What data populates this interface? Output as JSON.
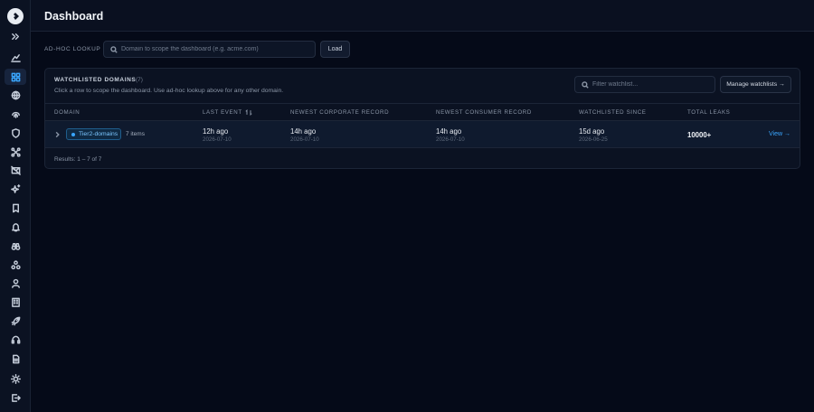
{
  "header": {
    "title": "Dashboard"
  },
  "lookup": {
    "label": "AD-HOC LOOKUP",
    "placeholder": "Domain to scope the dashboard (e.g. acme.com)",
    "value": "",
    "load_label": "Load"
  },
  "panel": {
    "title": "WATCHLISTED DOMAINS",
    "count": "(7)",
    "subtitle": "Click a row to scope the dashboard. Use ad-hoc lookup above for any other domain.",
    "filter_placeholder": "Filter watchlist...",
    "manage_label": "Manage watchlists →",
    "columns": [
      "DOMAIN",
      "LAST EVENT",
      "NEWEST CORPORATE RECORD",
      "NEWEST CONSUMER RECORD",
      "WATCHLISTED SINCE",
      "TOTAL LEAKS"
    ],
    "rows": [
      {
        "tag": "Tier2-domains",
        "items": "7 items",
        "last_event": "12h ago",
        "last_event_date": "2026-07-10",
        "corporate": "14h ago",
        "corporate_date": "2026-07-10",
        "consumer": "14h ago",
        "consumer_date": "2026-07-10",
        "since": "15d ago",
        "since_date": "2026-06-25",
        "total_leaks": "10000+",
        "view_label": "View →"
      }
    ],
    "results": "Results: 1 – 7 of 7"
  },
  "colors": {
    "background": "#050a18",
    "panel": "#0b1222",
    "accent": "#3aa6ff"
  },
  "sidebar_icons": [
    "expand-icon",
    "chart-icon",
    "grid-icon",
    "globe-icon",
    "fingerprint-icon",
    "shield-icon",
    "network-icon",
    "mail-off-icon",
    "sparkle-icon",
    "bookmark-icon",
    "bell-icon",
    "binoculars-icon",
    "team-icon",
    "user-icon",
    "building-icon",
    "rocket-icon",
    "headset-icon",
    "document-icon",
    "sun-icon",
    "logout-icon"
  ]
}
